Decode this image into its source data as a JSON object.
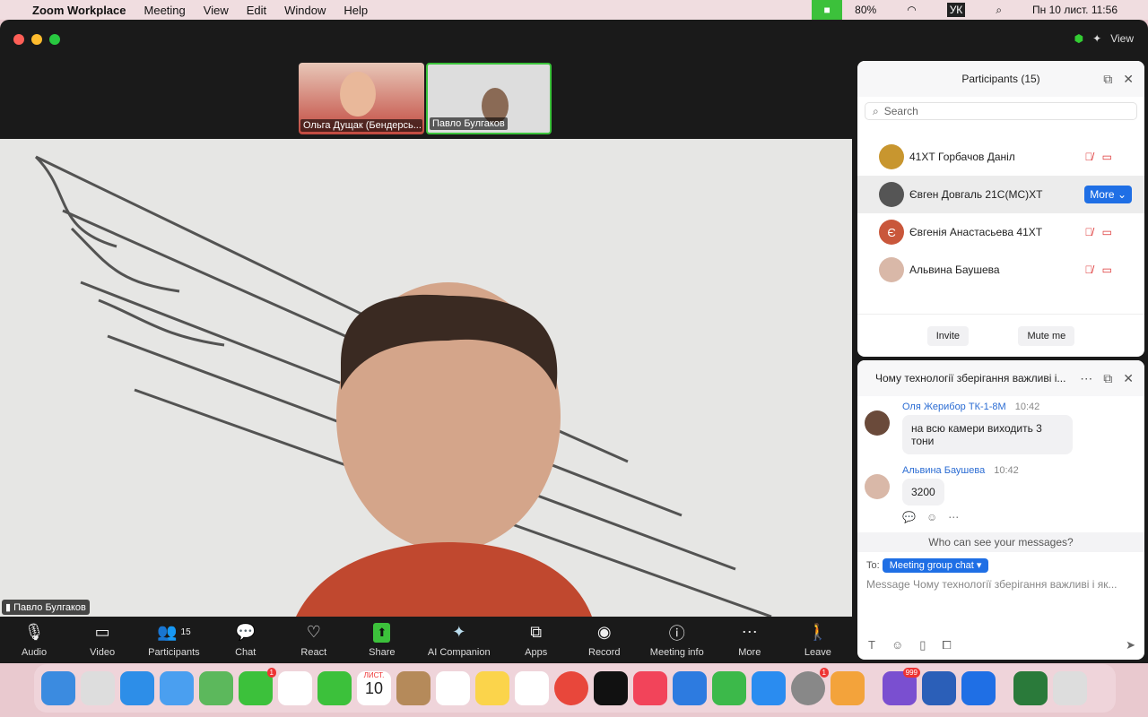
{
  "menubar": {
    "app": "Zoom Workplace",
    "items": [
      "Meeting",
      "View",
      "Edit",
      "Window",
      "Help"
    ],
    "battery": "80%",
    "lang": "УК",
    "datetime": "Пн 10 лист.  11:56"
  },
  "window": {
    "view_label": "View"
  },
  "thumbnails": [
    {
      "name": "Ольга Дущак (Бендерсь..."
    },
    {
      "name": "Павло Булгаков"
    }
  ],
  "main_video": {
    "name": "Павло Булгаков"
  },
  "toolbar": [
    {
      "label": "Audio",
      "icon": "🎙"
    },
    {
      "label": "Video",
      "icon": "▭"
    },
    {
      "label": "Participants",
      "icon": "👥",
      "count": "15"
    },
    {
      "label": "Chat",
      "icon": "💬"
    },
    {
      "label": "React",
      "icon": "♡"
    },
    {
      "label": "Share",
      "icon": "⬆"
    },
    {
      "label": "AI Companion",
      "icon": "✦"
    },
    {
      "label": "Apps",
      "icon": "⧉"
    },
    {
      "label": "Record",
      "icon": "◉"
    },
    {
      "label": "Meeting info",
      "icon": "ⓘ"
    },
    {
      "label": "More",
      "icon": "⋯"
    },
    {
      "label": "Leave",
      "icon": "🚶"
    }
  ],
  "participants": {
    "title": "Participants (15)",
    "search_placeholder": "Search",
    "rows": [
      {
        "name": "41ХТ Горбачов Даніл",
        "color": "#c8962f"
      },
      {
        "name": "Євген Довгаль 21С(МС)ХТ",
        "color": "#555"
      },
      {
        "name": "Євгенія Анастасьева 41ХТ",
        "color": "#c9573b",
        "initial": "Є"
      },
      {
        "name": "Альвина Баушева",
        "color": "#d9b8a8"
      }
    ],
    "more_label": "More",
    "invite": "Invite",
    "mute_me": "Mute me"
  },
  "chat": {
    "title": "Чому технології зберігання важливі і...",
    "messages": [
      {
        "sender": "Оля Жерибор ТК-1-8М",
        "time": "10:42",
        "text": "на всю камери виходить  3 тони"
      },
      {
        "sender": "Альвина Баушева",
        "time": "10:42",
        "text": "3200"
      }
    ],
    "who_can_see": "Who can see your messages?",
    "to_label": "To:",
    "recipient": "Meeting group chat",
    "placeholder": "Message Чому технології зберігання важливі і як..."
  },
  "dock": {
    "badges": {
      "messages": "1",
      "settings": "1",
      "viber": "999"
    },
    "calendar_month": "ЛИСТ.",
    "calendar_day": "10"
  }
}
